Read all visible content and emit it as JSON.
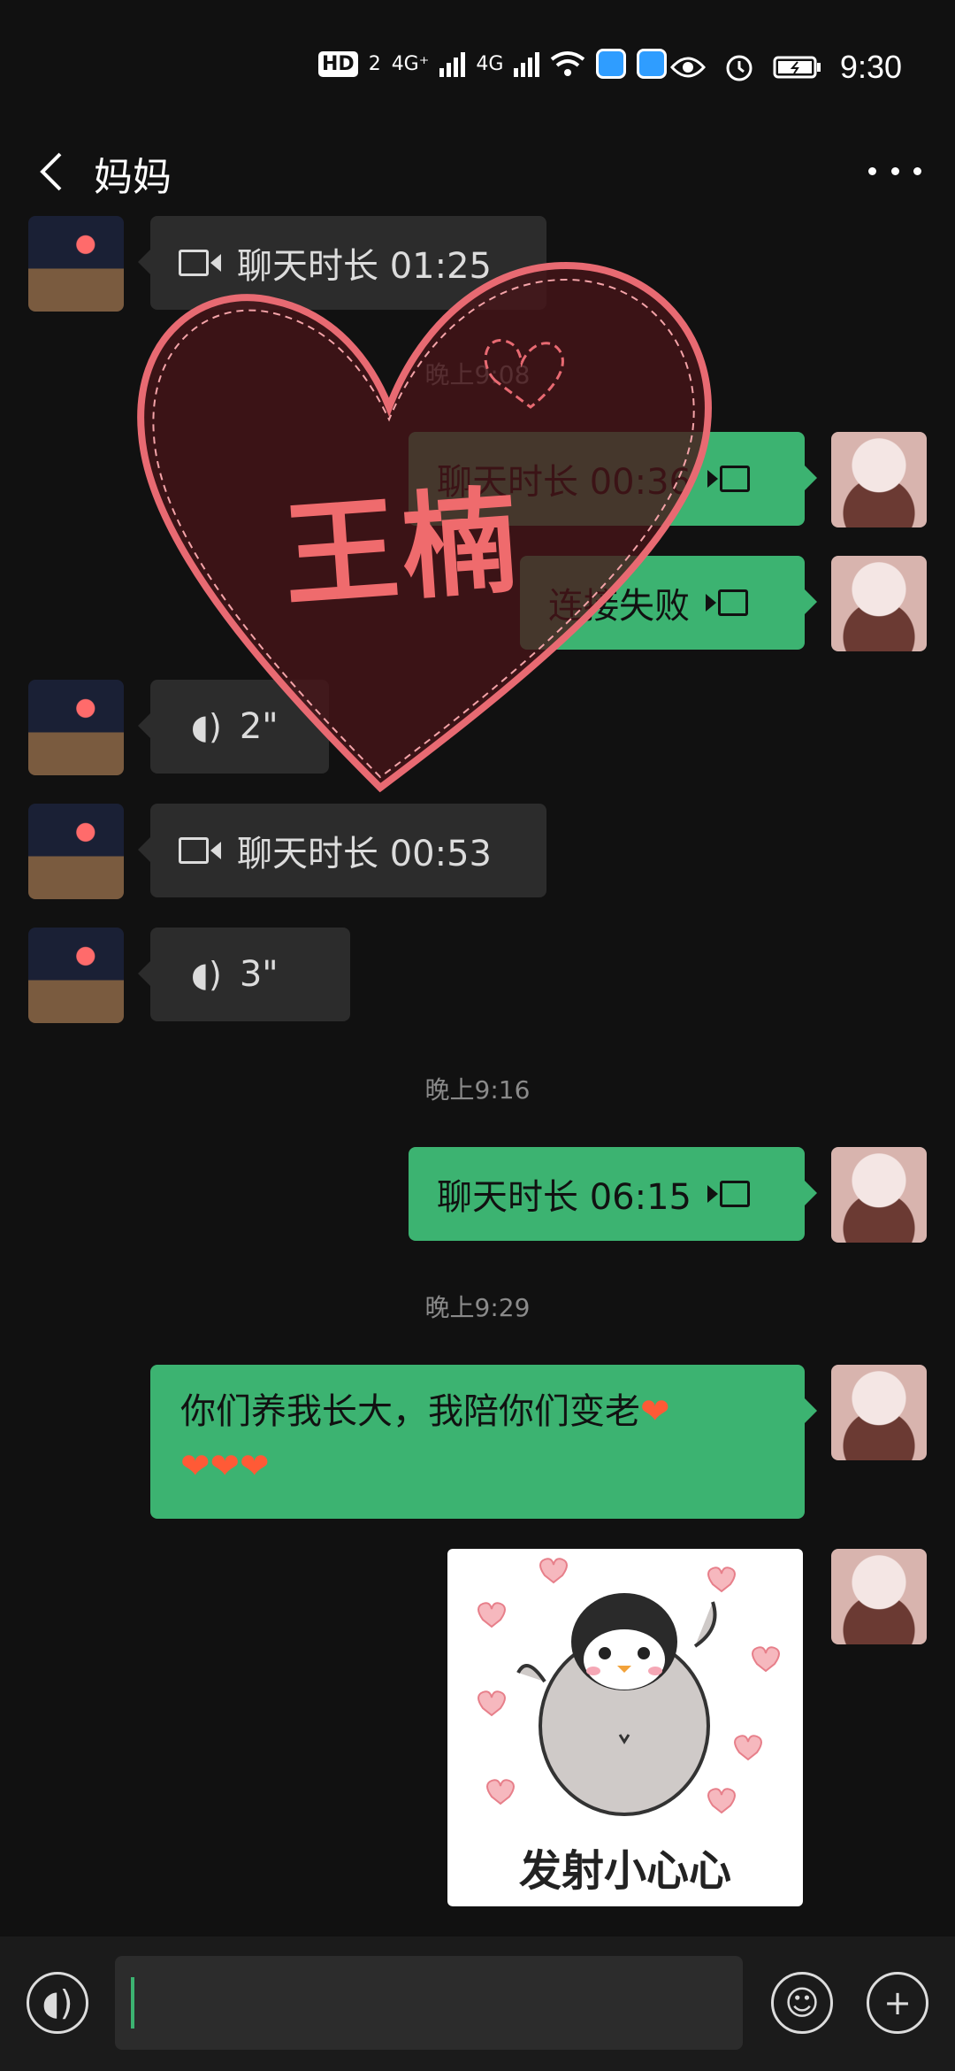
{
  "status_bar": {
    "hd_label": "HD",
    "hd_sub": "2",
    "net1": "4G⁺",
    "net2": "4G",
    "time": "9:30"
  },
  "header": {
    "title": "妈妈"
  },
  "messages": {
    "m1": "聊天时长 01:25",
    "t1": "晚上9:08",
    "m2": "聊天时长 00:36",
    "m3": "连接失败",
    "m4": "2\"",
    "m5": "聊天时长 00:53",
    "m6": "3\"",
    "t2": "晚上9:16",
    "m7": "聊天时长 06:15",
    "t3": "晚上9:29",
    "m8_line1": "你们养我长大，我陪你们变老",
    "m8_line2": "❤❤❤",
    "m8_heart": "❤",
    "sticker_text": "发射小心心"
  },
  "watermark": {
    "text": "王楠"
  },
  "colors": {
    "outgoing": "#3cb371",
    "incoming": "#2c2c2c",
    "watermark": "#ef6b6d"
  }
}
